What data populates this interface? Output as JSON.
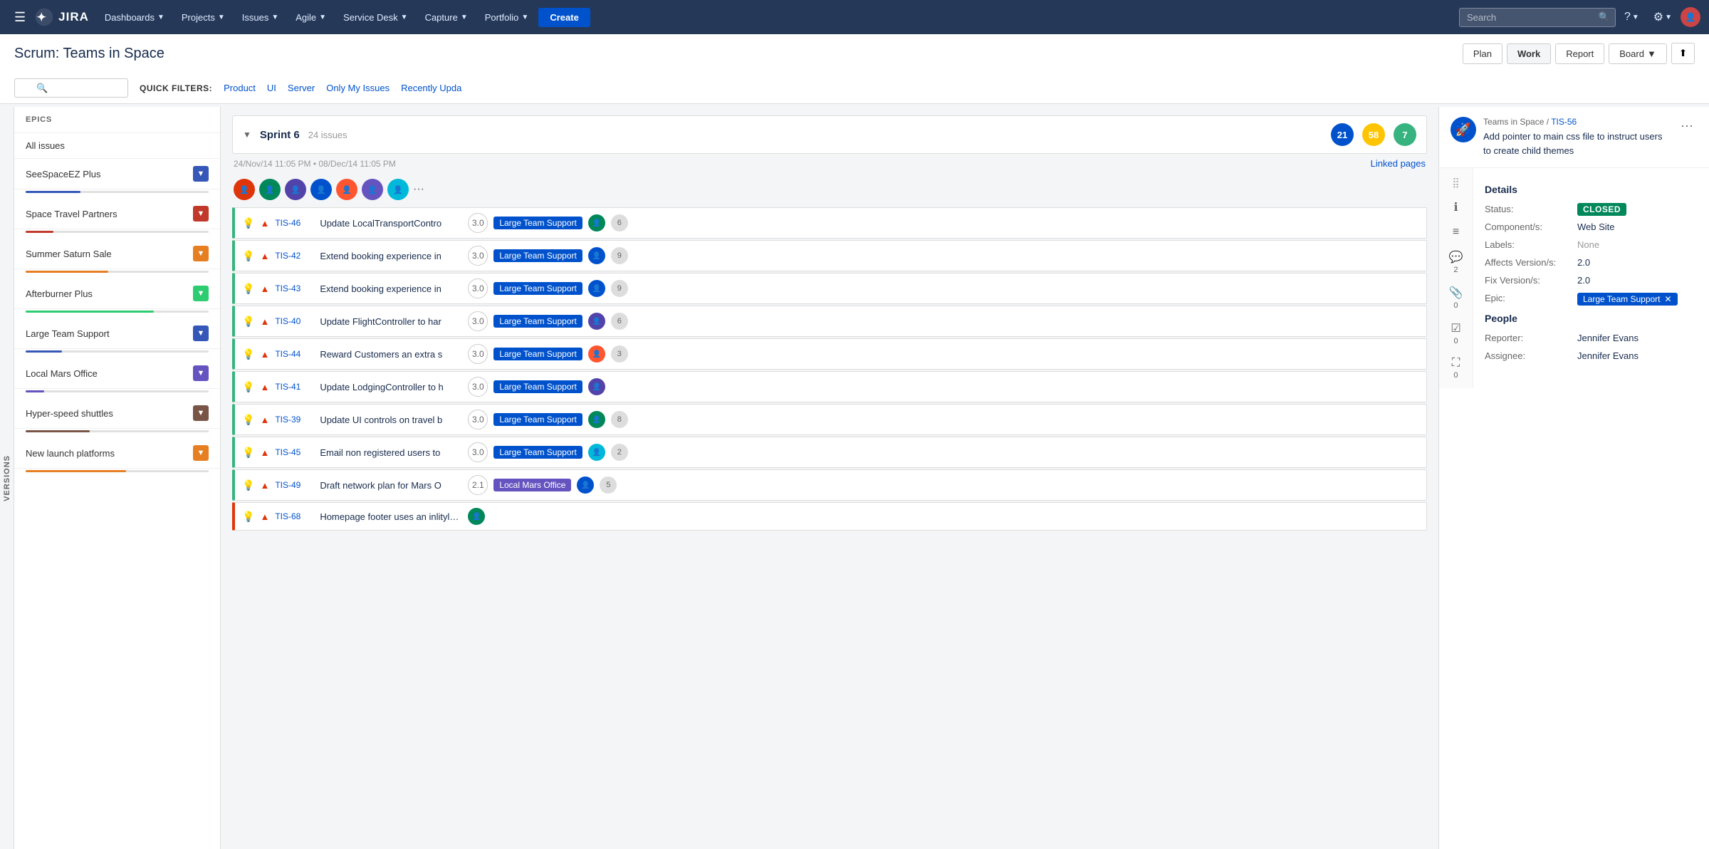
{
  "nav": {
    "hamburger_label": "☰",
    "logo_text": "JIRA",
    "items": [
      {
        "label": "Dashboards",
        "id": "dashboards"
      },
      {
        "label": "Projects",
        "id": "projects"
      },
      {
        "label": "Issues",
        "id": "issues"
      },
      {
        "label": "Agile",
        "id": "agile"
      },
      {
        "label": "Service Desk",
        "id": "service-desk"
      },
      {
        "label": "Capture",
        "id": "capture"
      },
      {
        "label": "Portfolio",
        "id": "portfolio"
      }
    ],
    "create_label": "Create",
    "search_placeholder": "Search",
    "help_label": "?",
    "settings_label": "⚙",
    "arrow": "▼"
  },
  "subheader": {
    "title": "Scrum: Teams in Space",
    "buttons": [
      {
        "label": "Plan",
        "id": "plan"
      },
      {
        "label": "Work",
        "id": "work",
        "active": true
      },
      {
        "label": "Report",
        "id": "report"
      },
      {
        "label": "Board",
        "id": "board"
      }
    ],
    "collapse_label": "⬆"
  },
  "filters": {
    "search_placeholder": "🔍",
    "quick_filters_label": "QUICK FILTERS:",
    "links": [
      {
        "label": "Product",
        "id": "product"
      },
      {
        "label": "UI",
        "id": "ui"
      },
      {
        "label": "Server",
        "id": "server"
      },
      {
        "label": "Only My Issues",
        "id": "my-issues"
      },
      {
        "label": "Recently Upda",
        "id": "recently-updated"
      }
    ]
  },
  "versions_tab": {
    "label": "VERSIONS"
  },
  "epics": {
    "header": "EPICS",
    "items": [
      {
        "name": "All issues",
        "color": null,
        "dropdown_color": null,
        "progress": 0
      },
      {
        "name": "SeeSpaceEZ Plus",
        "color": "#3557b7",
        "dropdown_color": "#3557b7",
        "progress": 30
      },
      {
        "name": "Space Travel Partners",
        "color": "#c0392b",
        "dropdown_color": "#c0392b",
        "progress": 15
      },
      {
        "name": "Summer Saturn Sale",
        "color": "#e67e22",
        "dropdown_color": "#e67e22",
        "progress": 45
      },
      {
        "name": "Afterburner Plus",
        "color": "#2ecc71",
        "dropdown_color": "#2ecc71",
        "progress": 70
      },
      {
        "name": "Large Team Support",
        "color": "#3557b7",
        "dropdown_color": "#3557b7",
        "progress": 20
      },
      {
        "name": "Local Mars Office",
        "color": "#6554c0",
        "dropdown_color": "#6554c0",
        "progress": 10
      },
      {
        "name": "Hyper-speed shuttles",
        "color": "#795548",
        "dropdown_color": "#795548",
        "progress": 35
      },
      {
        "name": "New launch platforms",
        "color": "#e67e22",
        "dropdown_color": "#e67e22",
        "progress": 55
      }
    ]
  },
  "sprint": {
    "name": "Sprint 6",
    "issue_count": "24 issues",
    "toggle": "▼",
    "dates": "24/Nov/14 11:05 PM  •  08/Dec/14 11:05 PM",
    "linked_pages": "Linked pages",
    "badges": [
      {
        "count": "21",
        "color": "#0052cc"
      },
      {
        "count": "58",
        "color": "#ffc400"
      },
      {
        "count": "7",
        "color": "#36b37e"
      }
    ],
    "more_label": "···"
  },
  "issues": [
    {
      "key": "TIS-46",
      "summary": "Update LocalTransportContro",
      "points": "3.0",
      "epic": "Large Team Support",
      "epic_color": "blue",
      "priority": "▲",
      "avatar_color": "av2",
      "count": "6",
      "left_color": "green"
    },
    {
      "key": "TIS-42",
      "summary": "Extend booking experience in",
      "points": "3.0",
      "epic": "Large Team Support",
      "epic_color": "blue",
      "priority": "▲",
      "avatar_color": "av3",
      "count": "9",
      "left_color": "green"
    },
    {
      "key": "TIS-43",
      "summary": "Extend booking experience in",
      "points": "3.0",
      "epic": "Large Team Support",
      "epic_color": "blue",
      "priority": "▲",
      "avatar_color": "av3",
      "count": "9",
      "left_color": "green"
    },
    {
      "key": "TIS-40",
      "summary": "Update FlightController to har",
      "points": "3.0",
      "epic": "Large Team Support",
      "epic_color": "blue",
      "priority": "▲",
      "avatar_color": "av1",
      "count": "6",
      "left_color": "green"
    },
    {
      "key": "TIS-44",
      "summary": "Reward Customers an extra s",
      "points": "3.0",
      "epic": "Large Team Support",
      "epic_color": "blue",
      "priority": "▲",
      "avatar_color": "av5",
      "count": "3",
      "left_color": "green"
    },
    {
      "key": "TIS-41",
      "summary": "Update LodgingController to h",
      "points": "3.0",
      "epic": "Large Team Support",
      "epic_color": "blue",
      "priority": "▲",
      "avatar_color": "av1",
      "count": "",
      "left_color": "green"
    },
    {
      "key": "TIS-39",
      "summary": "Update UI controls on travel b",
      "points": "3.0",
      "epic": "Large Team Support",
      "epic_color": "blue",
      "priority": "▲",
      "avatar_color": "av2",
      "count": "8",
      "left_color": "green"
    },
    {
      "key": "TIS-45",
      "summary": "Email non registered users to",
      "points": "3.0",
      "epic": "Large Team Support",
      "epic_color": "blue",
      "priority": "▲",
      "avatar_color": "av7",
      "count": "2",
      "left_color": "green"
    },
    {
      "key": "TIS-49",
      "summary": "Draft network plan for Mars O",
      "points": "2.1",
      "epic": "Local Mars Office",
      "epic_color": "purple",
      "priority": "▲",
      "avatar_color": "av3",
      "count": "5",
      "left_color": "green"
    },
    {
      "key": "TIS-68",
      "summary": "Homepage footer uses an inlityle - should be a class",
      "points": "",
      "epic": "",
      "epic_color": "",
      "priority": "▲",
      "avatar_color": "av2",
      "count": "",
      "left_color": "red"
    }
  ],
  "detail": {
    "breadcrumb_project": "Teams in Space",
    "breadcrumb_separator": " / ",
    "issue_key": "TIS-56",
    "title": "Add pointer to main css file to instruct users to create child themes",
    "more_label": "···",
    "sections": {
      "details_title": "Details",
      "status_label": "Status:",
      "status_value": "CLOSED",
      "components_label": "Component/s:",
      "components_value": "Web Site",
      "labels_label": "Labels:",
      "labels_value": "None",
      "affects_label": "Affects Version/s:",
      "affects_value": "2.0",
      "fix_label": "Fix Version/s:",
      "fix_value": "2.0",
      "epic_label": "Epic:",
      "epic_value": "Large Team Support",
      "people_title": "People",
      "reporter_label": "Reporter:",
      "reporter_value": "Jennifer Evans",
      "assignee_label": "Assignee:",
      "assignee_value": "Jennifer Evans"
    },
    "icons": [
      {
        "name": "drag-icon",
        "symbol": "⣿",
        "count": ""
      },
      {
        "name": "info-icon",
        "symbol": "ℹ",
        "count": ""
      },
      {
        "name": "description-icon",
        "symbol": "≡",
        "count": ""
      },
      {
        "name": "comment-icon",
        "symbol": "💬",
        "count": "2"
      },
      {
        "name": "attachment-icon",
        "symbol": "📎",
        "count": "0"
      },
      {
        "name": "checklist-icon",
        "symbol": "☑",
        "count": "0"
      },
      {
        "name": "expand-icon",
        "symbol": "⛶",
        "count": "0"
      }
    ]
  }
}
